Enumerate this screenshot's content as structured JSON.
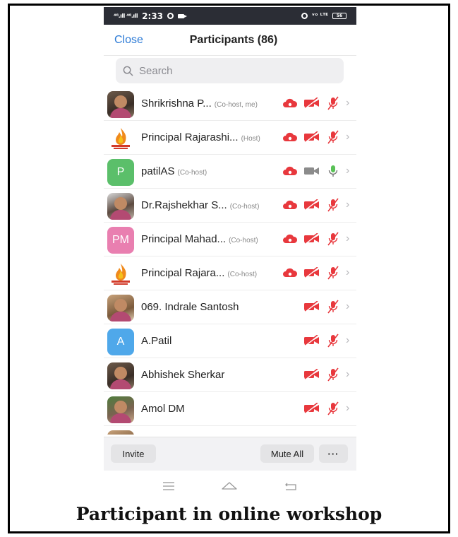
{
  "statusbar": {
    "signal": "⁴ᴳ.ıll ⁴ᴳ.ıll",
    "time": "2:33",
    "right_text": "ᵛᵒ ᴸᵀᴱ",
    "battery": "56"
  },
  "header": {
    "close_label": "Close",
    "title": "Participants (86)"
  },
  "search": {
    "placeholder": "Search"
  },
  "participants": [
    {
      "name": "Shrikrishna P...",
      "role": "(Co-host, me)",
      "avatar": "photo",
      "cloud": true,
      "video": "off",
      "audio": "muted"
    },
    {
      "name": "Principal Rajarashi...",
      "role": "(Host)",
      "avatar": "logo",
      "cloud": true,
      "video": "off",
      "audio": "muted"
    },
    {
      "name": "patilAS",
      "role": "(Co-host)",
      "avatar_letter": "P",
      "avatar_color": "#5bbf6a",
      "cloud": true,
      "video": "on",
      "audio": "on"
    },
    {
      "name": "Dr.Rajshekhar S...",
      "role": "(Co-host)",
      "avatar": "photo",
      "cloud": true,
      "video": "off",
      "audio": "muted"
    },
    {
      "name": "Principal Mahad...",
      "role": "(Co-host)",
      "avatar_letter": "PM",
      "avatar_color": "#e97fb0",
      "cloud": true,
      "video": "off",
      "audio": "muted"
    },
    {
      "name": "Principal Rajara...",
      "role": "(Co-host)",
      "avatar": "logo",
      "cloud": true,
      "video": "off",
      "audio": "muted"
    },
    {
      "name": "069. Indrale Santosh",
      "role": "",
      "avatar": "photo",
      "cloud": false,
      "video": "off",
      "audio": "muted"
    },
    {
      "name": "A.Patil",
      "role": "",
      "avatar_letter": "A",
      "avatar_color": "#4fa8ea",
      "cloud": false,
      "video": "off",
      "audio": "muted"
    },
    {
      "name": "Abhishek Sherkar",
      "role": "",
      "avatar": "photo",
      "cloud": false,
      "video": "off",
      "audio": "muted"
    },
    {
      "name": "Amol DM",
      "role": "",
      "avatar": "photo",
      "cloud": false,
      "video": "off",
      "audio": "muted"
    },
    {
      "name": "",
      "role": "",
      "avatar": "photo",
      "cloud": false,
      "video": "off",
      "audio": "muted"
    }
  ],
  "bottom": {
    "invite_label": "Invite",
    "mute_all_label": "Mute All",
    "more_label": "···"
  },
  "caption": "Participant in online workshop",
  "colors": {
    "accent": "#2d7bd6",
    "muted_red": "#e8383d",
    "mic_green": "#59c156"
  }
}
